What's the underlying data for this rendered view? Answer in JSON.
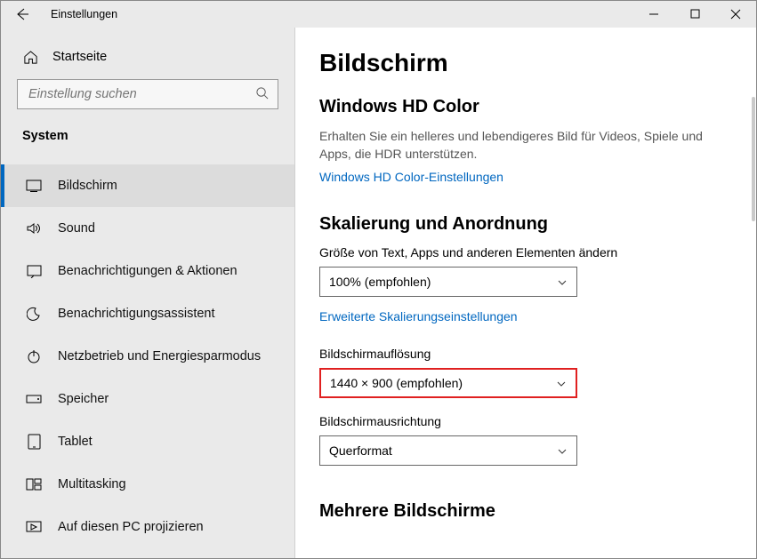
{
  "window": {
    "title": "Einstellungen"
  },
  "sidebar": {
    "home": "Startseite",
    "search_placeholder": "Einstellung suchen",
    "category": "System",
    "items": [
      {
        "label": "Bildschirm"
      },
      {
        "label": "Sound"
      },
      {
        "label": "Benachrichtigungen & Aktionen"
      },
      {
        "label": "Benachrichtigungsassistent"
      },
      {
        "label": "Netzbetrieb und Energiesparmodus"
      },
      {
        "label": "Speicher"
      },
      {
        "label": "Tablet"
      },
      {
        "label": "Multitasking"
      },
      {
        "label": "Auf diesen PC projizieren"
      }
    ]
  },
  "content": {
    "page_title": "Bildschirm",
    "hdcolor": {
      "heading": "Windows HD Color",
      "body": "Erhalten Sie ein helleres und lebendigeres Bild für Videos, Spiele und Apps, die HDR unterstützen.",
      "link": "Windows HD Color-Einstellungen"
    },
    "scaling": {
      "heading": "Skalierung und Anordnung",
      "size_label": "Größe von Text, Apps und anderen Elementen ändern",
      "size_value": "100% (empfohlen)",
      "advanced_link": "Erweiterte Skalierungseinstellungen",
      "res_label": "Bildschirmauflösung",
      "res_value": "1440 × 900 (empfohlen)",
      "orient_label": "Bildschirmausrichtung",
      "orient_value": "Querformat"
    },
    "multi": {
      "heading": "Mehrere Bildschirme"
    }
  }
}
